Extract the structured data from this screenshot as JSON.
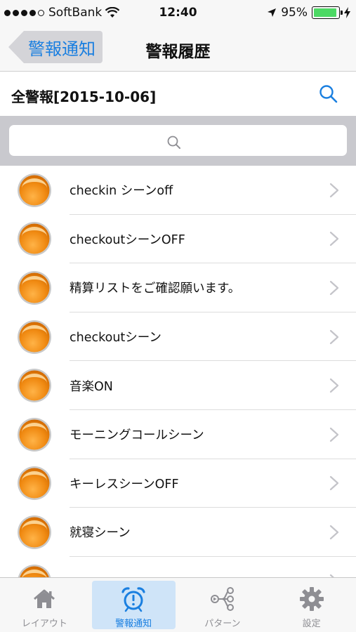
{
  "status_bar": {
    "carrier": "SoftBank",
    "time": "12:40",
    "battery_percent": "95%",
    "battery_level": 0.95
  },
  "nav": {
    "back_label": "警報通知",
    "title": "警報履歴"
  },
  "subheader": {
    "label": "全警報[2015-10-06]"
  },
  "search": {
    "placeholder": ""
  },
  "list": {
    "items": [
      {
        "label": "checkin シーンoff"
      },
      {
        "label": "checkoutシーンOFF"
      },
      {
        "label": "精算リストをご確認願います。"
      },
      {
        "label": "checkoutシーン"
      },
      {
        "label": "音楽ON"
      },
      {
        "label": "モーニングコールシーン"
      },
      {
        "label": "キーレスシーンOFF"
      },
      {
        "label": "就寝シーン"
      },
      {
        "label": ""
      }
    ]
  },
  "tabs": [
    {
      "label": "レイアウト",
      "icon": "home-icon"
    },
    {
      "label": "警報通知",
      "icon": "alarm-clock-icon"
    },
    {
      "label": "パターン",
      "icon": "pattern-icon"
    },
    {
      "label": "設定",
      "icon": "gear-icon"
    }
  ],
  "colors": {
    "accent": "#1a7fe0",
    "orb": "#f39a1e",
    "battery": "#4cd964",
    "active_tab_bg": "#cfe4f8"
  }
}
